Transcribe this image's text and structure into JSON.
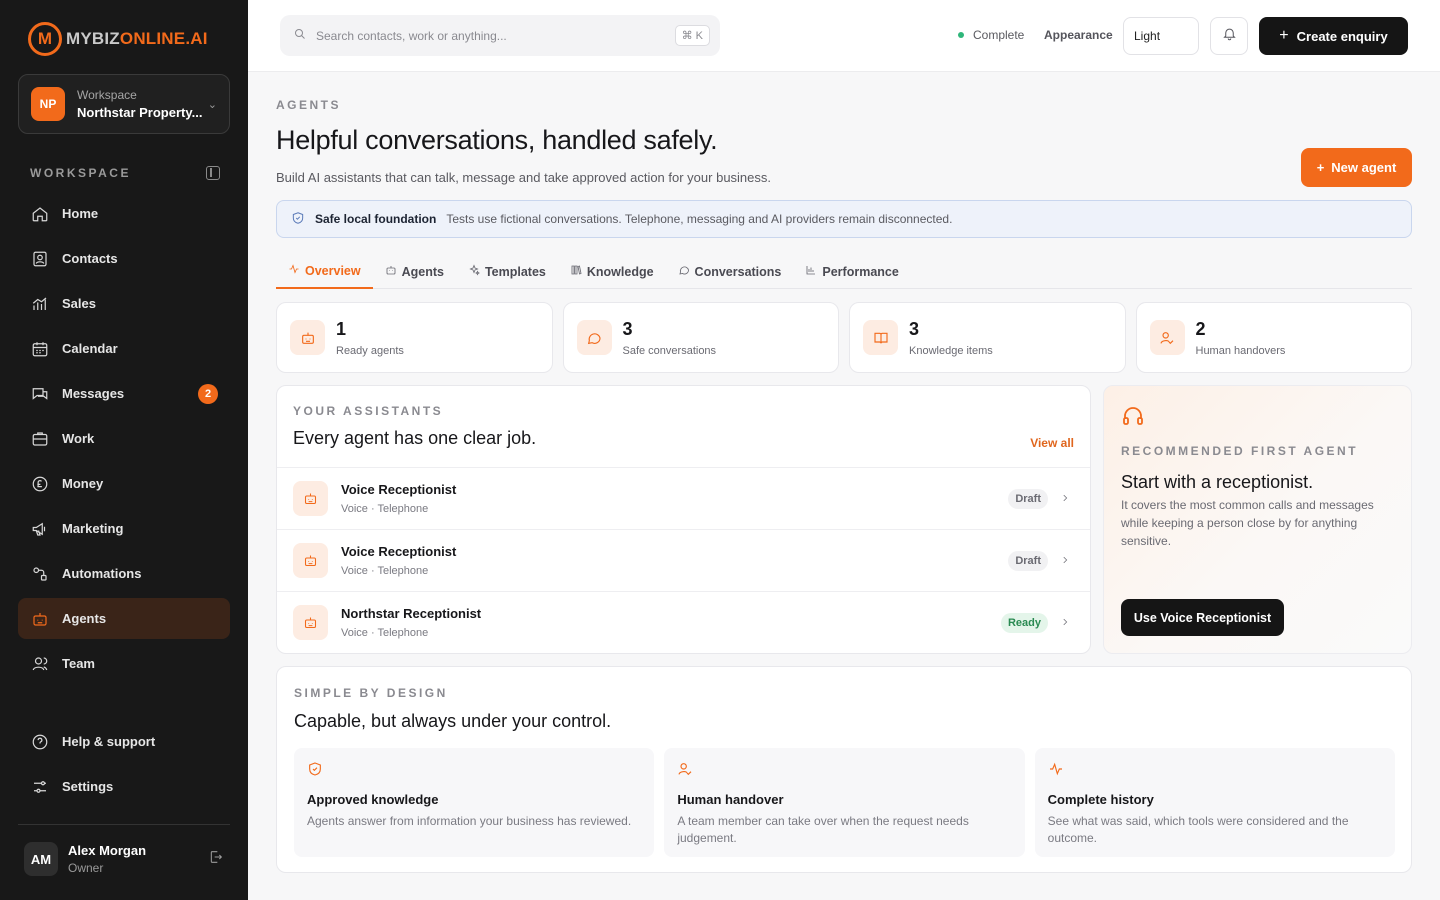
{
  "brand": {
    "logo_letter": "M",
    "name_part1": "MYBIZ",
    "name_part2": "ONLINE.AI",
    "accent_color": "#f26a1b"
  },
  "workspace": {
    "avatar": "NP",
    "label": "Workspace",
    "name": "Northstar Property..."
  },
  "sidebar": {
    "section_label": "WORKSPACE",
    "items": [
      {
        "label": "Home",
        "icon": "home-icon"
      },
      {
        "label": "Contacts",
        "icon": "contacts-icon"
      },
      {
        "label": "Sales",
        "icon": "sales-icon"
      },
      {
        "label": "Calendar",
        "icon": "calendar-icon"
      },
      {
        "label": "Messages",
        "icon": "messages-icon",
        "badge": "2"
      },
      {
        "label": "Work",
        "icon": "work-icon"
      },
      {
        "label": "Money",
        "icon": "money-icon"
      },
      {
        "label": "Marketing",
        "icon": "marketing-icon"
      },
      {
        "label": "Automations",
        "icon": "automations-icon"
      },
      {
        "label": "Agents",
        "icon": "agents-icon",
        "active": true
      },
      {
        "label": "Team",
        "icon": "team-icon"
      }
    ],
    "bottom_items": [
      {
        "label": "Help & support",
        "icon": "help-icon"
      },
      {
        "label": "Settings",
        "icon": "settings-icon"
      }
    ]
  },
  "user": {
    "avatar": "AM",
    "name": "Alex Morgan",
    "role": "Owner"
  },
  "topbar": {
    "search_placeholder": "Search contacts, work or anything...",
    "search_shortcut": "⌘ K",
    "status": "Complete",
    "appearance_label": "Appearance",
    "appearance_value": "Light",
    "create_label": "Create enquiry"
  },
  "page": {
    "eyebrow": "AGENTS",
    "title": "Helpful conversations, handled safely.",
    "subtitle": "Build AI assistants that can talk, message and take approved action for your business.",
    "new_agent_label": "New agent",
    "notice_title": "Safe local foundation",
    "notice_text": "Tests use fictional conversations. Telephone, messaging and AI providers remain disconnected."
  },
  "tabs": [
    {
      "label": "Overview",
      "icon": "activity-icon",
      "active": true
    },
    {
      "label": "Agents",
      "icon": "robot-icon"
    },
    {
      "label": "Templates",
      "icon": "sparkle-icon"
    },
    {
      "label": "Knowledge",
      "icon": "book-icon"
    },
    {
      "label": "Conversations",
      "icon": "chat-icon"
    },
    {
      "label": "Performance",
      "icon": "bar-chart-icon"
    }
  ],
  "stats": [
    {
      "value": "1",
      "label": "Ready agents",
      "icon": "robot-icon"
    },
    {
      "value": "3",
      "label": "Safe conversations",
      "icon": "chat-icon"
    },
    {
      "value": "3",
      "label": "Knowledge items",
      "icon": "book-icon"
    },
    {
      "value": "2",
      "label": "Human handovers",
      "icon": "user-check-icon"
    }
  ],
  "assistants": {
    "eyebrow": "YOUR ASSISTANTS",
    "title": "Every agent has one clear job.",
    "view_all": "View all",
    "rows": [
      {
        "name": "Voice Receptionist",
        "meta": "Voice · Telephone",
        "status": "Draft",
        "status_kind": "draft"
      },
      {
        "name": "Voice Receptionist",
        "meta": "Voice · Telephone",
        "status": "Draft",
        "status_kind": "draft"
      },
      {
        "name": "Northstar Receptionist",
        "meta": "Voice · Telephone",
        "status": "Ready",
        "status_kind": "ready"
      }
    ]
  },
  "recommend": {
    "eyebrow": "RECOMMENDED FIRST AGENT",
    "title": "Start with a receptionist.",
    "text": "It covers the most common calls and messages while keeping a person close by for anything sensitive.",
    "button": "Use Voice Receptionist"
  },
  "design": {
    "eyebrow": "SIMPLE BY DESIGN",
    "title": "Capable, but always under your control.",
    "features": [
      {
        "title": "Approved knowledge",
        "text": "Agents answer from information your business has reviewed.",
        "icon": "shield-check-icon"
      },
      {
        "title": "Human handover",
        "text": "A team member can take over when the request needs judgement.",
        "icon": "user-check-icon"
      },
      {
        "title": "Complete history",
        "text": "See what was said, which tools were considered and the outcome.",
        "icon": "activity-icon"
      }
    ]
  }
}
